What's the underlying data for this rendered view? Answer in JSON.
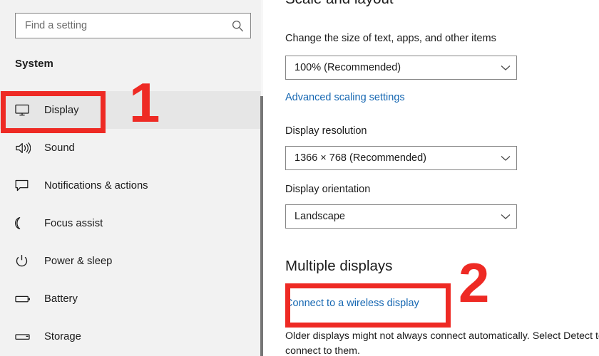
{
  "search": {
    "placeholder": "Find a setting",
    "value": "",
    "icon": "search-icon"
  },
  "sidebar": {
    "section_title": "System",
    "items": [
      {
        "label": "Display",
        "icon": "monitor-icon",
        "selected": true
      },
      {
        "label": "Sound",
        "icon": "speaker-icon",
        "selected": false
      },
      {
        "label": "Notifications & actions",
        "icon": "chat-bubble-icon",
        "selected": false
      },
      {
        "label": "Focus assist",
        "icon": "moon-icon",
        "selected": false
      },
      {
        "label": "Power & sleep",
        "icon": "power-icon",
        "selected": false
      },
      {
        "label": "Battery",
        "icon": "battery-icon",
        "selected": false
      },
      {
        "label": "Storage",
        "icon": "storage-disk-icon",
        "selected": false
      }
    ]
  },
  "main": {
    "scale_layout_heading": "Scale and layout",
    "scale_label": "Change the size of text, apps, and other items",
    "scale_value": "100% (Recommended)",
    "advanced_scaling_link": "Advanced scaling settings",
    "resolution_label": "Display resolution",
    "resolution_value": "1366 × 768 (Recommended)",
    "orientation_label": "Display orientation",
    "orientation_value": "Landscape",
    "multiple_displays_heading": "Multiple displays",
    "wireless_display_link": "Connect to a wireless display",
    "multiple_displays_note": "Older displays might not always connect automatically. Select Detect to try to connect to them.",
    "dropdown_arrow_icon": "chevron-down-icon"
  },
  "annotations": {
    "step_one": "1",
    "step_two": "2",
    "accent_color": "#ee2a24"
  },
  "colors": {
    "sidebar_bg": "#f2f2f2",
    "panel_bg": "#ffffff",
    "link_blue": "#1667b2",
    "text": "#1b1b1b",
    "border": "#868686",
    "annotation_red": "#ee2a24",
    "selected_item_bg": "#e6e6e6"
  }
}
